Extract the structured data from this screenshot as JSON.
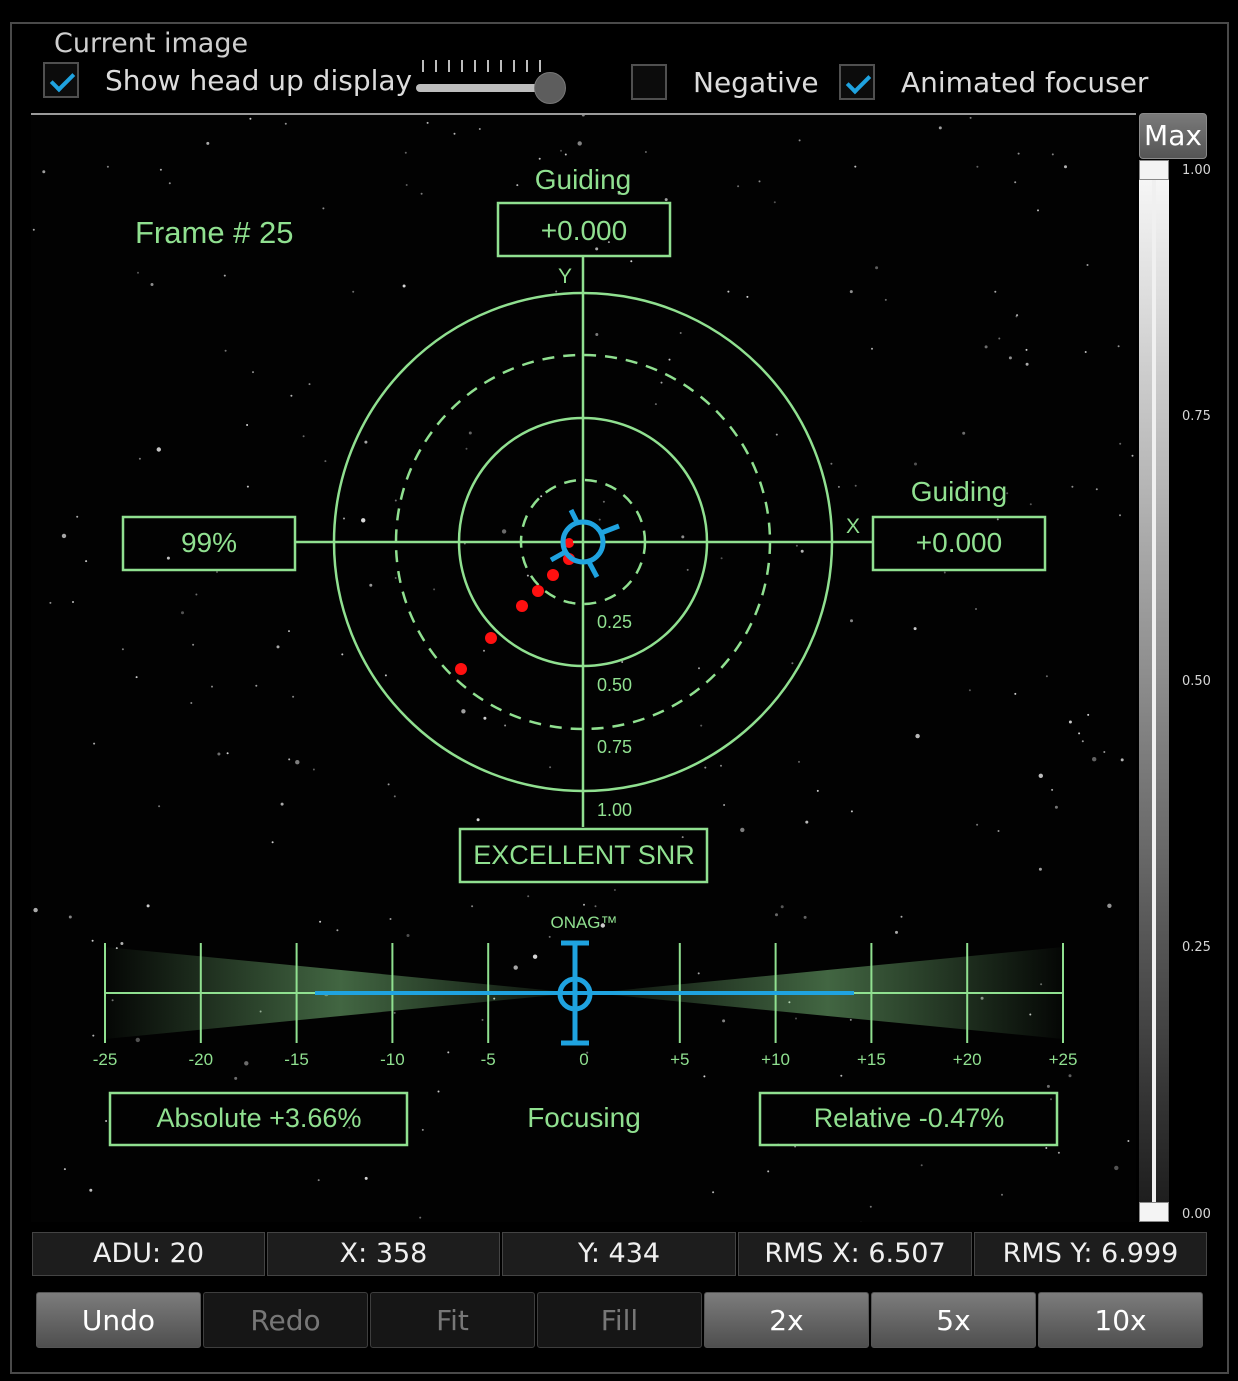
{
  "group_title": "Current image",
  "options": {
    "hud_label": "Show head up display",
    "hud_checked": true,
    "negative_label": "Negative",
    "negative_checked": false,
    "animated_label": "Animated focuser",
    "animated_checked": true,
    "hud_opacity_fraction": 0.87
  },
  "hud": {
    "frame": "Frame # 25",
    "guiding_top_label": "Guiding",
    "guiding_top_value": "+0.000",
    "axis_y": "Y",
    "axis_x": "X",
    "guiding_right_label": "Guiding",
    "guiding_right_value": "+0.000",
    "quality_value": "99%",
    "snr": "EXCELLENT SNR",
    "ring_labels": [
      "0.25",
      "0.50",
      "0.75",
      "1.00"
    ],
    "onag": "ONAG™",
    "focus_ticks": [
      "-25",
      "-20",
      "-15",
      "-10",
      "-5",
      "0",
      "+5",
      "+10",
      "+15",
      "+20",
      "+25"
    ],
    "absolute": "Absolute +3.66%",
    "focusing": "Focusing",
    "relative": "Relative -0.47%",
    "hud_color": "#90e090",
    "cursor_color": "#1fa3e0",
    "trail_color": "#ff1010"
  },
  "scale": {
    "max_label": "Max",
    "ticks": [
      "1.00",
      "0.75",
      "0.50",
      "0.25",
      "0.00"
    ]
  },
  "status": {
    "adu": "ADU: 20",
    "x": "X: 358",
    "y": "Y: 434",
    "rms_x": "RMS X: 6.507",
    "rms_y": "RMS Y: 6.999"
  },
  "buttons": {
    "undo": "Undo",
    "redo": "Redo",
    "fit": "Fit",
    "fill": "Fill",
    "z2": "2x",
    "z5": "5x",
    "z10": "10x"
  }
}
